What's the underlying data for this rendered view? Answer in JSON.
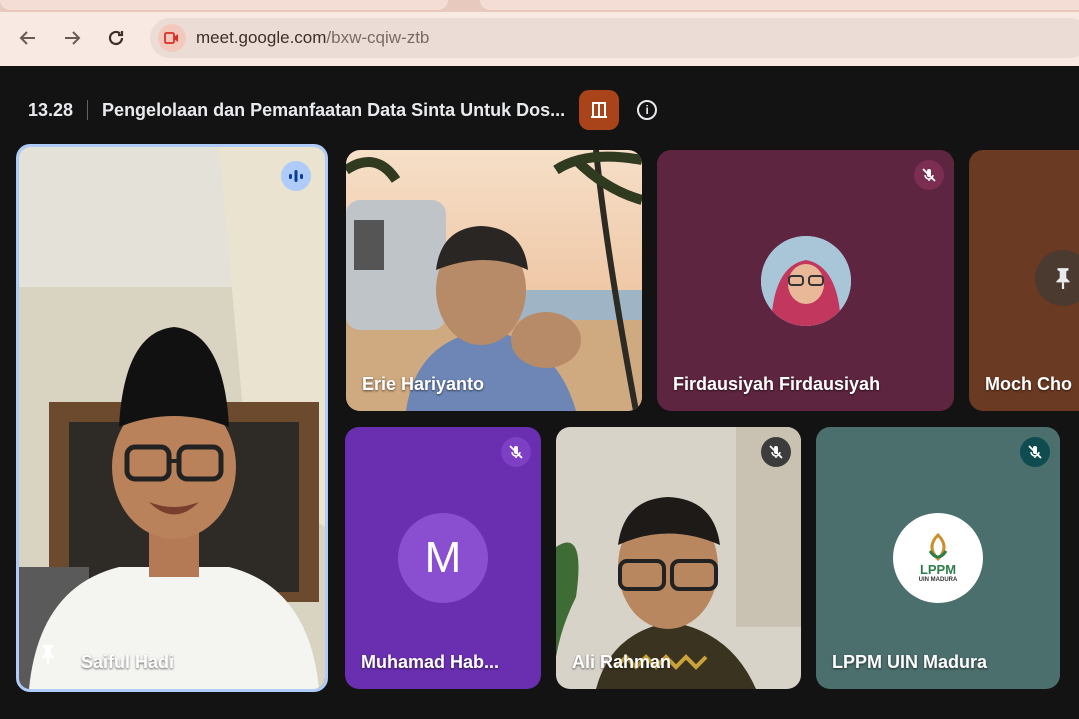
{
  "browser": {
    "url_host": "meet.google.com",
    "url_path": "/bxw-cqiw-ztb",
    "back_icon": "arrow-left-icon",
    "forward_icon": "arrow-right-icon",
    "reload_icon": "reload-icon"
  },
  "meeting": {
    "time": "13.28",
    "title": "Pengelolaan dan Pemanfaatan Data Sinta Untuk Dos..."
  },
  "participants": [
    {
      "name": "Saiful Hadi",
      "pinned": true,
      "speaking": true
    },
    {
      "name": "Erie Hariyanto",
      "muted": false
    },
    {
      "name": "Firdausiyah Firdausiyah",
      "muted": true
    },
    {
      "name": "Moch Cho",
      "pinned": true
    },
    {
      "name": "Muhamad Hab...",
      "muted": true,
      "initial": "M"
    },
    {
      "name": "Ali Rahman",
      "muted": true
    },
    {
      "name": "LPPM UIN Madura",
      "muted": true,
      "logo_text": "LPPM",
      "logo_subtext": "UIN MADURA"
    }
  ],
  "colors": {
    "accent_speaking": "#aecbfa",
    "host_badge": "#a8431a",
    "tile_firdausiyah": "#5e2540",
    "tile_muhamad": "#6a2fb0",
    "tile_lppm": "#4b6f6d"
  }
}
